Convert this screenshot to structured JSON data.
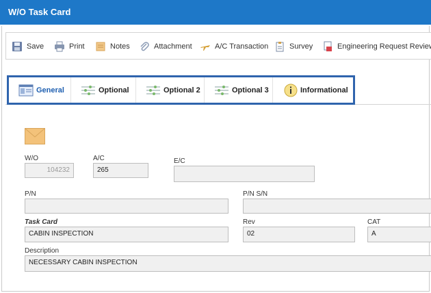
{
  "window": {
    "title": "W/O Task Card"
  },
  "toolbar": {
    "save": "Save",
    "print": "Print",
    "notes": "Notes",
    "attachment": "Attachment",
    "ac_transaction": "A/C Transaction",
    "survey": "Survey",
    "engineering_request_review": "Engineering Request Review"
  },
  "tabs": [
    {
      "label": "General",
      "icon": "form-icon",
      "active": true
    },
    {
      "label": "Optional",
      "icon": "sliders-icon"
    },
    {
      "label": "Optional 2",
      "icon": "sliders-icon"
    },
    {
      "label": "Optional 3",
      "icon": "sliders-icon"
    },
    {
      "label": "Informational",
      "icon": "info-icon"
    }
  ],
  "form": {
    "wo": {
      "label": "W/O",
      "value": "104232"
    },
    "ac": {
      "label": "A/C",
      "value": "265"
    },
    "ec": {
      "label": "E/C",
      "value": ""
    },
    "pn": {
      "label": "P/N",
      "value": ""
    },
    "pn_sn": {
      "label": "P/N S/N",
      "value": ""
    },
    "task_card": {
      "label": "Task Card",
      "value": "CABIN INSPECTION"
    },
    "rev": {
      "label": "Rev",
      "value": "02"
    },
    "cat": {
      "label": "CAT",
      "value": "A"
    },
    "description": {
      "label": "Description",
      "value": "NECESSARY CABIN INSPECTION"
    }
  },
  "colors": {
    "titlebar": "#1e78c8",
    "tab_highlight": "#2f64ad",
    "envelope": "#f3c27a"
  }
}
